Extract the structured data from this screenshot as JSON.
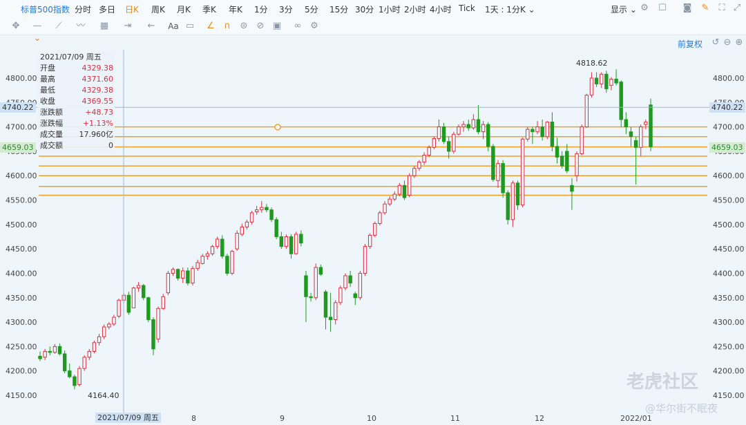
{
  "topbar": {
    "symbol": "标普500指数",
    "periods": [
      "分时",
      "多日",
      "日K",
      "周K",
      "月K",
      "季K",
      "年K",
      "1分",
      "3分",
      "5分",
      "15分",
      "30分",
      "1小时",
      "2小时",
      "4小时",
      "Tick"
    ],
    "active_period": "日K",
    "interval_select": "1天 : 1分K",
    "display_label": "显示"
  },
  "toolbar": {
    "icons": [
      "crosshair-move-icon",
      "line-style-icon",
      "drawing-tools-icon",
      "wave-icon",
      "measure-icon",
      "range-icon",
      "arrow-icon",
      "text-aa-icon",
      "comment-icon",
      "pencil-icon",
      "magnet-icon",
      "lock-icon",
      "hide-icon",
      "trash-icon",
      "link-icon",
      "settings-icon"
    ],
    "text_tool": "Aa"
  },
  "chart_controls": {
    "adjust_label": "前复权"
  },
  "info_panel": {
    "date": "2021/07/09 周五",
    "rows": [
      {
        "label": "开盘",
        "value": "4329.38"
      },
      {
        "label": "最高",
        "value": "4371.60"
      },
      {
        "label": "最低",
        "value": "4329.38"
      },
      {
        "label": "收盘",
        "value": "4369.55"
      },
      {
        "label": "涨跌额",
        "value": "+48.73"
      },
      {
        "label": "涨跌幅",
        "value": "+1.13%"
      },
      {
        "label": "成交量",
        "value": "17.960亿"
      },
      {
        "label": "成交额",
        "value": "0"
      }
    ]
  },
  "price_tags": {
    "crosshair": "4740.22",
    "last": "4659.03"
  },
  "crosshair_date": "2021/07/09 周五",
  "annotations": {
    "high": "4818.62",
    "low": "4164.40"
  },
  "watermark": {
    "logo": "老虎社区",
    "author": "@华尔街不眠夜"
  },
  "colors": {
    "up": "#e0303a",
    "down": "#1e9a1e",
    "hline": "#f0a028",
    "crosshair": "#9cb8d4"
  },
  "chart_data": {
    "type": "candlestick",
    "y_ticks": [
      "4150.00",
      "4200.00",
      "4250.00",
      "4300.00",
      "4350.00",
      "4400.00",
      "4450.00",
      "4500.00",
      "4550.00",
      "4600.00",
      "4650.00",
      "4700.00",
      "4750.00",
      "4800.00"
    ],
    "x_labels": [
      "8",
      "9",
      "10",
      "11",
      "12",
      "2022/01"
    ],
    "ylim": [
      4125,
      4840
    ],
    "horizontal_levels": [
      4700,
      4680,
      4659,
      4640,
      4620,
      4600,
      4578,
      4560
    ],
    "candles": [
      [
        4230,
        4240,
        4220,
        4225
      ],
      [
        4228,
        4245,
        4222,
        4240
      ],
      [
        4240,
        4250,
        4232,
        4238
      ],
      [
        4238,
        4255,
        4235,
        4250
      ],
      [
        4250,
        4256,
        4232,
        4235
      ],
      [
        4235,
        4242,
        4195,
        4200
      ],
      [
        4200,
        4215,
        4185,
        4188
      ],
      [
        4188,
        4192,
        4162,
        4170
      ],
      [
        4172,
        4210,
        4168,
        4205
      ],
      [
        4205,
        4232,
        4200,
        4228
      ],
      [
        4228,
        4245,
        4222,
        4240
      ],
      [
        4240,
        4262,
        4236,
        4258
      ],
      [
        4258,
        4276,
        4252,
        4270
      ],
      [
        4270,
        4295,
        4265,
        4290
      ],
      [
        4290,
        4300,
        4285,
        4296
      ],
      [
        4296,
        4315,
        4292,
        4310
      ],
      [
        4312,
        4348,
        4308,
        4345
      ],
      [
        4345,
        4360,
        4338,
        4355
      ],
      [
        4355,
        4362,
        4315,
        4320
      ],
      [
        4329,
        4372,
        4329,
        4370
      ],
      [
        4370,
        4382,
        4362,
        4375
      ],
      [
        4375,
        4378,
        4345,
        4350
      ],
      [
        4350,
        4352,
        4300,
        4305
      ],
      [
        4305,
        4310,
        4232,
        4245
      ],
      [
        4265,
        4332,
        4258,
        4328
      ],
      [
        4328,
        4358,
        4325,
        4352
      ],
      [
        4360,
        4405,
        4355,
        4400
      ],
      [
        4400,
        4412,
        4395,
        4408
      ],
      [
        4408,
        4410,
        4385,
        4390
      ],
      [
        4390,
        4412,
        4380,
        4405
      ],
      [
        4405,
        4412,
        4375,
        4380
      ],
      [
        4380,
        4415,
        4375,
        4410
      ],
      [
        4410,
        4428,
        4405,
        4422
      ],
      [
        4420,
        4440,
        4418,
        4435
      ],
      [
        4435,
        4445,
        4428,
        4440
      ],
      [
        4440,
        4458,
        4436,
        4455
      ],
      [
        4455,
        4475,
        4450,
        4470
      ],
      [
        4470,
        4478,
        4430,
        4435
      ],
      [
        4435,
        4440,
        4395,
        4400
      ],
      [
        4400,
        4448,
        4396,
        4445
      ],
      [
        4450,
        4488,
        4446,
        4482
      ],
      [
        4480,
        4502,
        4476,
        4495
      ],
      [
        4495,
        4510,
        4490,
        4505
      ],
      [
        4505,
        4528,
        4500,
        4524
      ],
      [
        4526,
        4538,
        4520,
        4530
      ],
      [
        4530,
        4548,
        4524,
        4535
      ],
      [
        4535,
        4542,
        4525,
        4530
      ],
      [
        4530,
        4535,
        4505,
        4510
      ],
      [
        4510,
        4515,
        4470,
        4475
      ],
      [
        4475,
        4485,
        4450,
        4455
      ],
      [
        4455,
        4480,
        4450,
        4475
      ],
      [
        4475,
        4480,
        4430,
        4440
      ],
      [
        4440,
        4485,
        4438,
        4480
      ],
      [
        4480,
        4488,
        4455,
        4462
      ],
      [
        4395,
        4405,
        4300,
        4352
      ],
      [
        4352,
        4360,
        4342,
        4350
      ],
      [
        4350,
        4420,
        4345,
        4412
      ],
      [
        4412,
        4418,
        4395,
        4398
      ],
      [
        4362,
        4366,
        4285,
        4310
      ],
      [
        4310,
        4360,
        4280,
        4305
      ],
      [
        4305,
        4345,
        4295,
        4340
      ],
      [
        4340,
        4375,
        4335,
        4370
      ],
      [
        4370,
        4400,
        4365,
        4395
      ],
      [
        4395,
        4405,
        4372,
        4380
      ],
      [
        4358,
        4362,
        4335,
        4350
      ],
      [
        4350,
        4405,
        4345,
        4400
      ],
      [
        4400,
        4460,
        4395,
        4455
      ],
      [
        4455,
        4482,
        4450,
        4478
      ],
      [
        4478,
        4506,
        4474,
        4502
      ],
      [
        4502,
        4528,
        4498,
        4524
      ],
      [
        4524,
        4548,
        4520,
        4542
      ],
      [
        4542,
        4558,
        4538,
        4552
      ],
      [
        4552,
        4568,
        4548,
        4562
      ],
      [
        4562,
        4585,
        4558,
        4580
      ],
      [
        4580,
        4590,
        4550,
        4555
      ],
      [
        4560,
        4605,
        4556,
        4600
      ],
      [
        4600,
        4620,
        4595,
        4615
      ],
      [
        4615,
        4632,
        4610,
        4628
      ],
      [
        4628,
        4648,
        4622,
        4642
      ],
      [
        4642,
        4662,
        4638,
        4658
      ],
      [
        4658,
        4680,
        4654,
        4676
      ],
      [
        4676,
        4715,
        4670,
        4700
      ],
      [
        4700,
        4708,
        4665,
        4670
      ],
      [
        4670,
        4680,
        4635,
        4650
      ],
      [
        4650,
        4690,
        4645,
        4685
      ],
      [
        4685,
        4705,
        4682,
        4700
      ],
      [
        4700,
        4712,
        4690,
        4705
      ],
      [
        4705,
        4715,
        4692,
        4698
      ],
      [
        4698,
        4726,
        4694,
        4715
      ],
      [
        4715,
        4745,
        4685,
        4690
      ],
      [
        4690,
        4712,
        4675,
        4705
      ],
      [
        4705,
        4710,
        4650,
        4660
      ],
      [
        4660,
        4665,
        4588,
        4592
      ],
      [
        4590,
        4632,
        4575,
        4625
      ],
      [
        4625,
        4632,
        4555,
        4565
      ],
      [
        4565,
        4570,
        4500,
        4510
      ],
      [
        4510,
        4590,
        4495,
        4585
      ],
      [
        4585,
        4590,
        4530,
        4540
      ],
      [
        4540,
        4678,
        4535,
        4675
      ],
      [
        4675,
        4700,
        4670,
        4695
      ],
      [
        4695,
        4700,
        4665,
        4690
      ],
      [
        4690,
        4712,
        4685,
        4700
      ],
      [
        4700,
        4715,
        4672,
        4680
      ],
      [
        4680,
        4712,
        4675,
        4710
      ],
      [
        4710,
        4730,
        4650,
        4660
      ],
      [
        4660,
        4678,
        4625,
        4638
      ],
      [
        4640,
        4650,
        4615,
        4620
      ],
      [
        4650,
        4665,
        4605,
        4610
      ],
      [
        4580,
        4595,
        4530,
        4568
      ],
      [
        4600,
        4650,
        4588,
        4645
      ],
      [
        4645,
        4705,
        4642,
        4700
      ],
      [
        4700,
        4768,
        4698,
        4765
      ],
      [
        4765,
        4812,
        4760,
        4800
      ],
      [
        4800,
        4812,
        4782,
        4788
      ],
      [
        4788,
        4812,
        4780,
        4808
      ],
      [
        4808,
        4815,
        4770,
        4778
      ],
      [
        4785,
        4802,
        4775,
        4798
      ],
      [
        4798,
        4818,
        4785,
        4790
      ],
      [
        4792,
        4795,
        4700,
        4715
      ],
      [
        4715,
        4730,
        4685,
        4700
      ],
      [
        4690,
        4700,
        4660,
        4680
      ],
      [
        4672,
        4680,
        4582,
        4658
      ],
      [
        4658,
        4705,
        4640,
        4700
      ],
      [
        4705,
        4715,
        4695,
        4710
      ],
      [
        4745,
        4758,
        4650,
        4659
      ]
    ]
  }
}
